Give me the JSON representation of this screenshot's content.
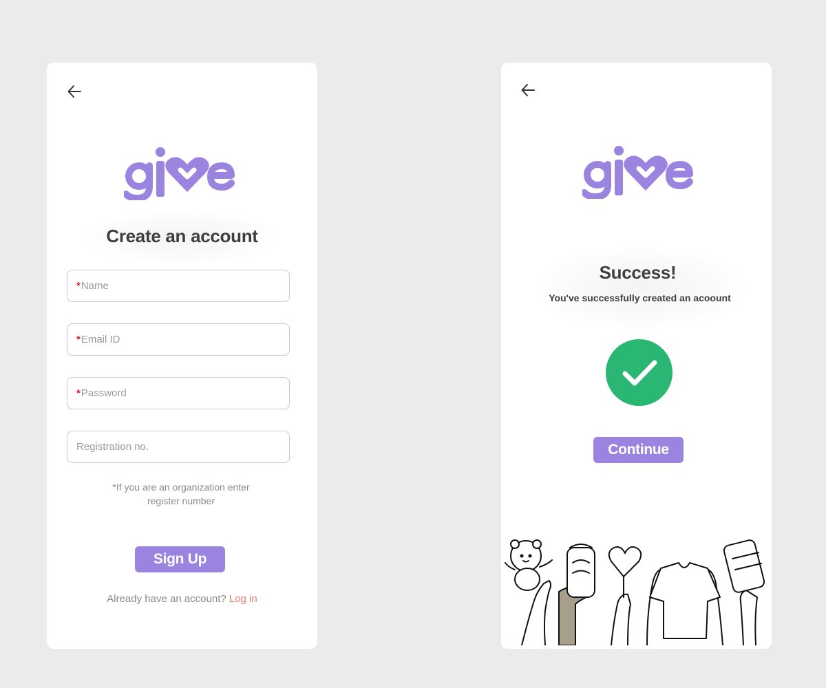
{
  "signup": {
    "logo_text": "give",
    "title": "Create an account",
    "fields": [
      {
        "required": true,
        "placeholder": "Name"
      },
      {
        "required": true,
        "placeholder": "Email ID"
      },
      {
        "required": true,
        "placeholder": "Password"
      },
      {
        "required": false,
        "placeholder": "Registration no."
      }
    ],
    "required_mark": "*",
    "hint_line1": "*If you  are an organization enter",
    "hint_line2": "register number",
    "signup_button": "Sign Up",
    "login_prompt": "Already have an account?",
    "login_link": "Log in"
  },
  "success": {
    "logo_text": "give",
    "title": "Success!",
    "message": "You've successfully created an acoount",
    "continue_button": "Continue"
  },
  "icons": {
    "back": "arrow-left-icon",
    "check": "check-circle-icon"
  },
  "colors": {
    "brand": "#9b84e0",
    "accent_link": "#e97a6b",
    "success": "#2ab673",
    "required": "#d81f26",
    "background": "#ebebeb"
  }
}
